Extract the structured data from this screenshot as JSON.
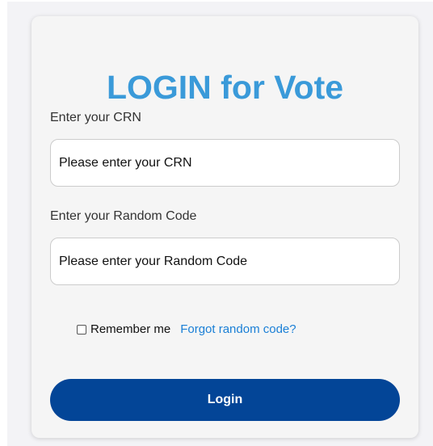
{
  "login_form": {
    "title": "LOGIN for Vote",
    "crn_label": "Enter your CRN",
    "crn_placeholder": "Please enter your CRN",
    "crn_value": "",
    "code_label": "Enter your Random Code",
    "code_placeholder": "Please enter your Random Code",
    "code_value": "",
    "remember_label": "Remember me",
    "remember_checked": false,
    "forgot_link": "Forgot random code?",
    "login_button": "Login"
  },
  "colors": {
    "title": "#3a9ad9",
    "link": "#1a7fd6",
    "button": "#034597",
    "card": "#f5f5f5"
  }
}
